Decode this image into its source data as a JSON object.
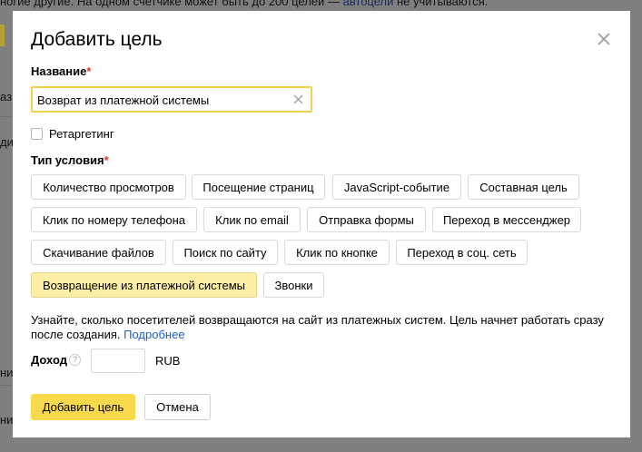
{
  "background": {
    "top_text_before": "ногие другие. На одном счетчике может быть до 200 целей — ",
    "top_link": "автоцели",
    "top_text_after": " не учитываются.",
    "side_texts": [
      "аз",
      "ди",
      "ни",
      "ни"
    ]
  },
  "modal": {
    "title": "Добавить цель",
    "name_label": "Название",
    "required_mark": "*",
    "name_value": "Возврат из платежной системы",
    "retargeting_label": "Ретаргетинг",
    "condition_label": "Тип условия",
    "condition_types": [
      "Количество просмотров",
      "Посещение страниц",
      "JavaScript-событие",
      "Составная цель",
      "Клик по номеру телефона",
      "Клик по email",
      "Отправка формы",
      "Переход в мессенджер",
      "Скачивание файлов",
      "Поиск по сайту",
      "Клик по кнопке",
      "Переход в соц. сеть",
      "Возвращение из платежной системы",
      "Звонки"
    ],
    "selected_condition": "Возвращение из платежной системы",
    "info_text": "Узнайте, сколько посетителей возвращаются на сайт из платежных систем. Цель начнет работать сразу после создания. ",
    "info_link": "Подробнее",
    "income_label": "Доход",
    "help_icon_text": "?",
    "income_value": "",
    "currency": "RUB",
    "submit_label": "Добавить цель",
    "cancel_label": "Отмена"
  },
  "colors": {
    "accent_yellow": "#f9d94c",
    "selected_chip": "#fdeea6",
    "required_red": "#e0312b",
    "link_blue": "#1a5fc7",
    "overlay_gray": "#7f7f7f"
  },
  "icons": {
    "close": "close-icon",
    "clear": "clear-icon",
    "help": "question-icon"
  }
}
